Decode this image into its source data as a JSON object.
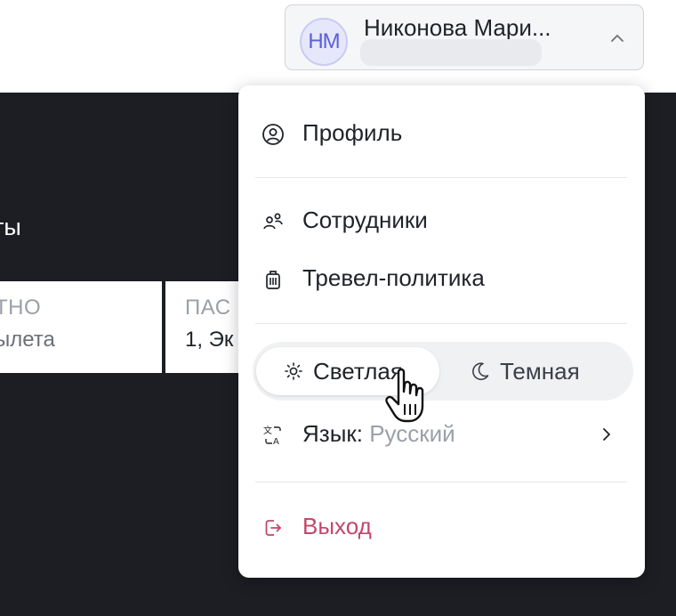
{
  "background": {
    "heading_fragment": "ты",
    "cards": [
      {
        "label": "ТНО",
        "value": "ылета"
      },
      {
        "label": "ПАС",
        "value": "1, Эк"
      }
    ]
  },
  "user": {
    "initials": "НМ",
    "name": "Никонова Мари..."
  },
  "menu": {
    "profile": "Профиль",
    "employees": "Сотрудники",
    "travel_policy": "Тревел-политика",
    "theme": {
      "light": "Светлая",
      "dark": "Темная",
      "selected": "light"
    },
    "language": {
      "label": "Язык:",
      "value": "Русский"
    },
    "logout": "Выход"
  },
  "colors": {
    "dark_bg": "#1c1e24",
    "avatar_text": "#5a5fd8",
    "logout": "#c4476a"
  }
}
